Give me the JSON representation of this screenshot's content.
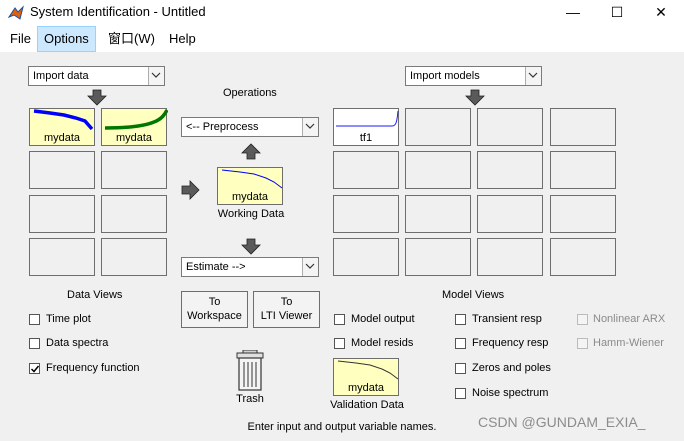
{
  "window": {
    "title": "System Identification - Untitled",
    "minimize_glyph": "—",
    "maximize_glyph": "☐",
    "close_glyph": "✕"
  },
  "menu": [
    "File",
    "Options",
    "窗口(W)",
    "Help"
  ],
  "data_import": {
    "selected": "Import data"
  },
  "models_import": {
    "selected": "Import models"
  },
  "operations": {
    "title": "Operations",
    "preprocess": "<-- Preprocess",
    "estimate": "Estimate -->",
    "working_data_name": "mydata",
    "working_data_label": "Working Data"
  },
  "data_board": [
    {
      "name": "mydata",
      "color": "#0000ff"
    },
    {
      "name": "mydata",
      "color": "#007700"
    }
  ],
  "model_board": [
    {
      "name": "tf1"
    }
  ],
  "buttons": {
    "to_workspace": [
      "To",
      "Workspace"
    ],
    "to_lti_viewer": [
      "To",
      "LTI Viewer"
    ]
  },
  "trash_label": "Trash",
  "validation": {
    "name": "mydata",
    "label": "Validation Data"
  },
  "data_views": {
    "title": "Data Views",
    "items": [
      {
        "label": "Time plot",
        "checked": false
      },
      {
        "label": "Data spectra",
        "checked": false
      },
      {
        "label": "Frequency function",
        "checked": true
      }
    ]
  },
  "model_views": {
    "title": "Model Views",
    "col1": [
      {
        "label": "Model output",
        "checked": false
      },
      {
        "label": "Model resids",
        "checked": false
      }
    ],
    "col2": [
      {
        "label": "Transient resp",
        "checked": false
      },
      {
        "label": "Frequency resp",
        "checked": false
      },
      {
        "label": "Zeros and poles",
        "checked": false
      },
      {
        "label": "Noise spectrum",
        "checked": false
      }
    ],
    "col3": [
      {
        "label": "Nonlinear ARX",
        "checked": false,
        "enabled": false
      },
      {
        "label": "Hamm-Wiener",
        "checked": false,
        "enabled": false
      }
    ]
  },
  "status_text": "Enter input and output variable names.",
  "watermark": "CSDN @GUNDAM_EXIA_"
}
